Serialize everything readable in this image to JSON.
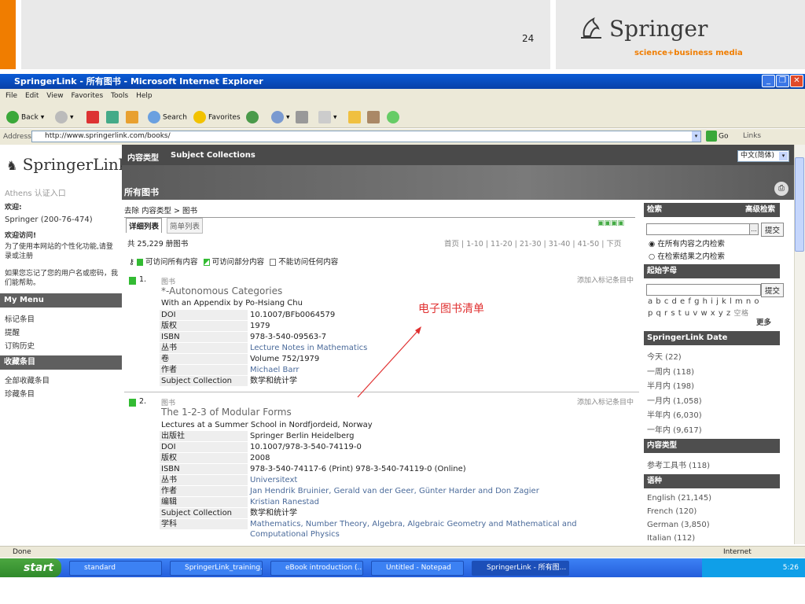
{
  "slide": {
    "number": "24",
    "brand": "Springer",
    "tagline": "science+business media"
  },
  "window": {
    "title": "SpringerLink - 所有图书 - Microsoft Internet Explorer"
  },
  "menubar": [
    "File",
    "Edit",
    "View",
    "Favorites",
    "Tools",
    "Help"
  ],
  "toolbar": {
    "back": "Back",
    "search": "Search",
    "favorites": "Favorites",
    "go": "Go",
    "links": "Links"
  },
  "address": {
    "label": "Address",
    "url": "http://www.springerlink.com/books/"
  },
  "sidebar": {
    "logo": "SpringerLink",
    "athens": "Athens 认证入口",
    "welcome": "欢迎:",
    "account": "Springer (200-76-474)",
    "welcome_visit": "欢迎访问!",
    "personal": "为了使用本网站的个性化功能,请登录或注册",
    "forgot": "如果您忘记了您的用户名或密码，我们能帮助。",
    "my_menu": "My Menu",
    "my_menu_items": [
      "标记条目",
      "提醒",
      "订购历史"
    ],
    "favorites_head": "收藏条目",
    "favorites_items": [
      "全部收藏条目",
      "珍藏条目"
    ]
  },
  "header": {
    "content_type": "内容类型",
    "subject": "Subject Collections",
    "all_books": "所有图书",
    "language": "中文(简体)"
  },
  "breadcrumb": "去除 内容类型 > 图书",
  "tabs": {
    "detail": "详细列表",
    "simple": "简单列表"
  },
  "results": {
    "count": "共 25,229 册图书",
    "pages": "首页 | 1-10 | 11-20 | 21-30 | 31-40 | 41-50 | 下页"
  },
  "access": {
    "all": "可访问所有内容",
    "partial": "可访问部分内容",
    "none": "不能访问任何内容"
  },
  "books": [
    {
      "num": "1.",
      "type": "图书",
      "add": "添加入标记条目中",
      "title": "*-Autonomous Categories",
      "subtitle": "With an Appendix by Po-Hsiang Chu",
      "rows": [
        [
          "DOI",
          "10.1007/BFb0064579"
        ],
        [
          "版权",
          "1979"
        ],
        [
          "ISBN",
          "978-3-540-09563-7"
        ],
        [
          "丛书",
          "Lecture Notes in Mathematics"
        ],
        [
          "卷",
          "Volume 752/1979"
        ],
        [
          "作者",
          "Michael Barr"
        ],
        [
          "Subject Collection",
          "数学和统计学"
        ]
      ]
    },
    {
      "num": "2.",
      "type": "图书",
      "add": "添加入标记条目中",
      "title": "The 1-2-3 of Modular Forms",
      "subtitle": "Lectures at a Summer School in Nordfjordeid, Norway",
      "rows": [
        [
          "出版社",
          "Springer Berlin Heidelberg"
        ],
        [
          "DOI",
          "10.1007/978-3-540-74119-0"
        ],
        [
          "版权",
          "2008"
        ],
        [
          "ISBN",
          "978-3-540-74117-6 (Print) 978-3-540-74119-0 (Online)"
        ],
        [
          "丛书",
          "Universitext"
        ],
        [
          "作者",
          "Jan Hendrik Bruinier, Gerald van der Geer, Günter Harder and Don Zagier"
        ],
        [
          "编辑",
          "Kristian Ranestad"
        ],
        [
          "Subject Collection",
          "数学和统计学"
        ],
        [
          "学科",
          "Mathematics, Number Theory, Algebra, Algebraic Geometry and Mathematical and Computational Physics"
        ]
      ]
    }
  ],
  "annotation": "电子图书清单",
  "right": {
    "search_head": "检索",
    "advanced": "高级检索",
    "submit": "提交",
    "radio_all": "在所有内容之内检索",
    "radio_results": "在检索结果之内检索",
    "letter_head": "起始字母",
    "letters1": "a b c d e f g h i j k l m n o",
    "letters2": "p q r s t u v w x y z",
    "space": "空格",
    "more": "更多",
    "date_head": "SpringerLink Date",
    "dates": [
      "今天 (22)",
      "一周内 (118)",
      "半月内 (198)",
      "一月内 (1,058)",
      "半年内 (6,030)",
      "一年内 (9,617)"
    ],
    "ctype_head": "内容类型",
    "ctypes": [
      "参考工具书 (118)"
    ],
    "lang_head": "语种",
    "langs": [
      "English (21,145)",
      "French (120)",
      "German (3,850)",
      "Italian (112)"
    ]
  },
  "status": {
    "done": "Done",
    "zone": "Internet"
  },
  "taskbar": {
    "start": "start",
    "tasks": [
      "standard",
      "SpringerLink_training...",
      "eBook introduction (...",
      "Untitled - Notepad",
      "SpringerLink - 所有图..."
    ],
    "time": "5:26"
  }
}
